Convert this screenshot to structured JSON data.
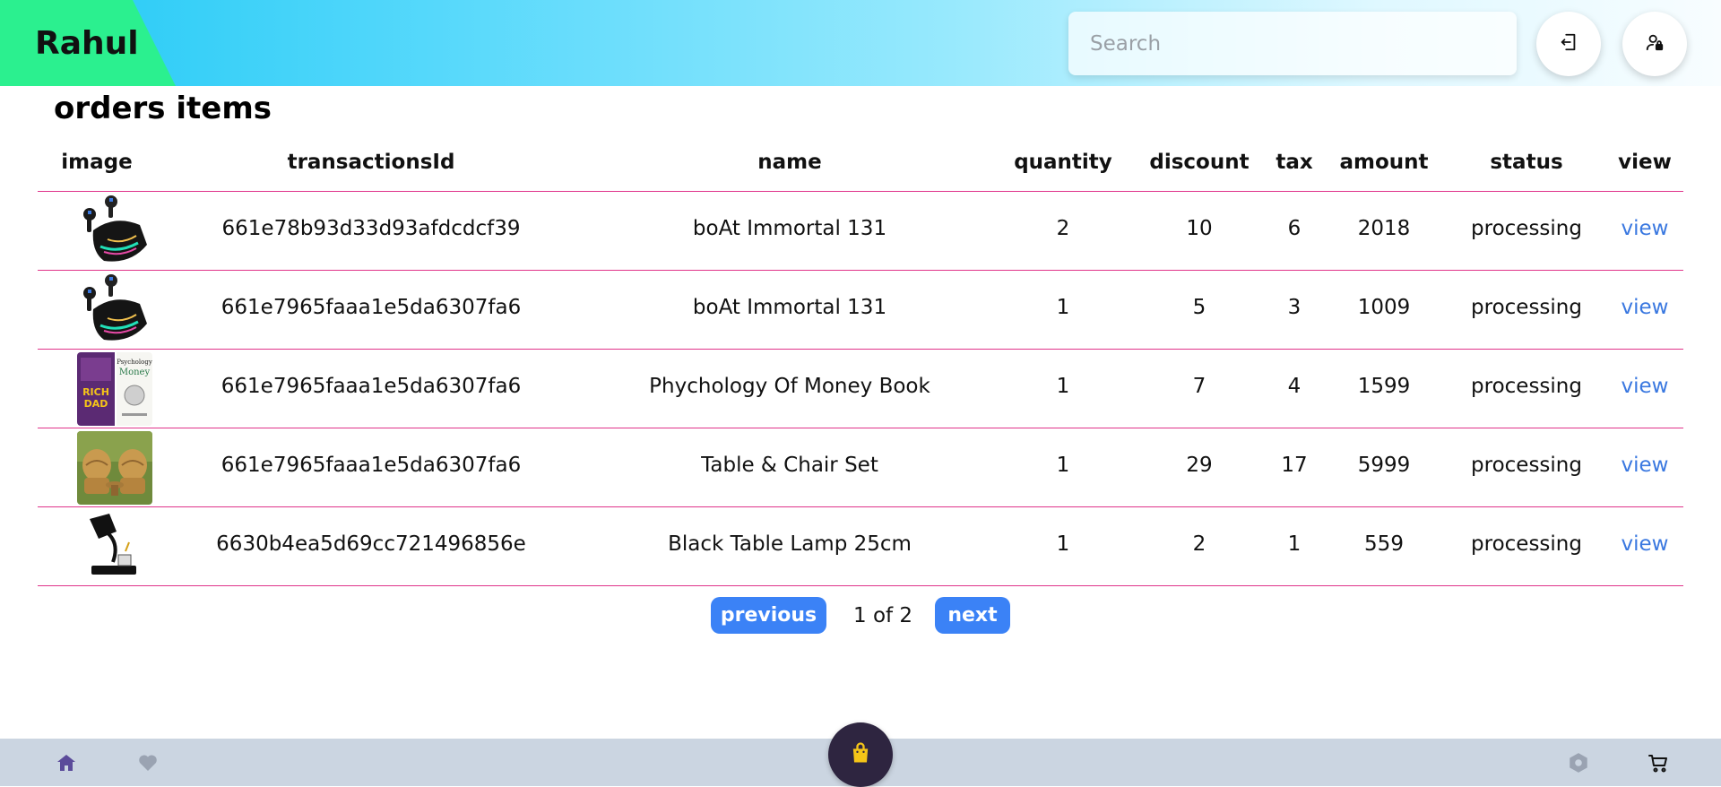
{
  "header": {
    "brand": "Rahul",
    "search_placeholder": "Search",
    "logout_icon": "logout-icon",
    "profile_icon": "user-lock-icon"
  },
  "page": {
    "title": "orders items"
  },
  "table": {
    "columns": [
      "image",
      "transactionsId",
      "name",
      "quantity",
      "discount",
      "tax",
      "amount",
      "status",
      "view"
    ],
    "rows": [
      {
        "image": "earbuds-product-image",
        "transactionsId": "661e78b93d33d93afdcdcf39",
        "name": "boAt Immortal 131",
        "quantity": "2",
        "discount": "10",
        "tax": "6",
        "amount": "2018",
        "status": "processing",
        "view": "view"
      },
      {
        "image": "earbuds-product-image",
        "transactionsId": "661e7965faaa1e5da6307fa6",
        "name": "boAt Immortal 131",
        "quantity": "1",
        "discount": "5",
        "tax": "3",
        "amount": "1009",
        "status": "processing",
        "view": "view"
      },
      {
        "image": "books-product-image",
        "transactionsId": "661e7965faaa1e5da6307fa6",
        "name": "Phychology Of Money Book",
        "quantity": "1",
        "discount": "7",
        "tax": "4",
        "amount": "1599",
        "status": "processing",
        "view": "view"
      },
      {
        "image": "chairs-product-image",
        "transactionsId": "661e7965faaa1e5da6307fa6",
        "name": "Table & Chair Set",
        "quantity": "1",
        "discount": "29",
        "tax": "17",
        "amount": "5999",
        "status": "processing",
        "view": "view"
      },
      {
        "image": "lamp-product-image",
        "transactionsId": "6630b4ea5d69cc721496856e",
        "name": "Black Table Lamp 25cm",
        "quantity": "1",
        "discount": "2",
        "tax": "1",
        "amount": "559",
        "status": "processing",
        "view": "view"
      }
    ]
  },
  "pagination": {
    "previous": "previous",
    "info": "1 of 2",
    "next": "next"
  },
  "bottombar": {
    "items": [
      "home-icon",
      "heart-icon",
      "shopping-bag-icon",
      "hexagon-icon",
      "cart-icon"
    ]
  },
  "colors": {
    "accent": "#3b82f6",
    "row_divider": "#e0338a",
    "brand_green": "#2bf08f",
    "link": "#3a78e0",
    "bottombar": "#cbd5e1"
  }
}
